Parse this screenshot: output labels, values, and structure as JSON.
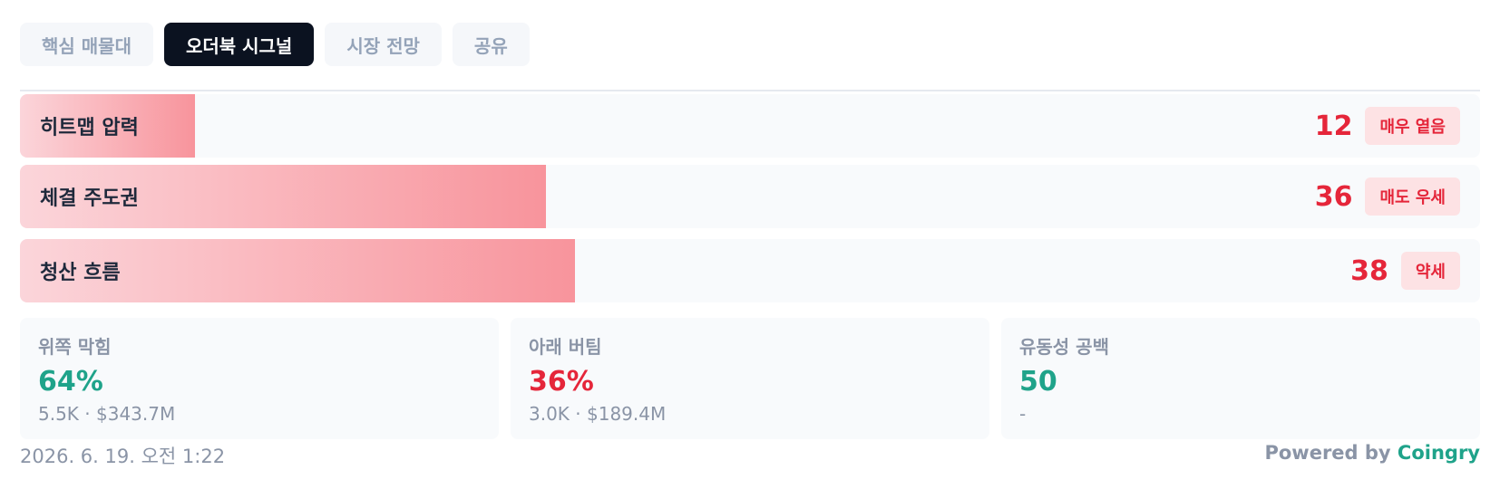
{
  "tabs": [
    {
      "label": "핵심 매물대",
      "active": false
    },
    {
      "label": "오더북 시그널",
      "active": true
    },
    {
      "label": "시장 전망",
      "active": false
    },
    {
      "label": "공유",
      "active": false
    }
  ],
  "signals": [
    {
      "label": "히트맵 압력",
      "value": "12",
      "level": 0.12,
      "badge": "매우 옅음"
    },
    {
      "label": "체결 주도권",
      "value": "36",
      "level": 0.36,
      "badge": "매도 우세"
    },
    {
      "label": "청산 흐름",
      "value": "38",
      "level": 0.38,
      "badge": "약세"
    }
  ],
  "cards": [
    {
      "title": "위쪽 막힘",
      "value": "64%",
      "sub": "5.5K · $343.7M",
      "value_color": "green"
    },
    {
      "title": "아래 버팀",
      "value": "36%",
      "sub": "3.0K · $189.4M",
      "value_color": "red"
    },
    {
      "title": "유동성 공백",
      "value": "50",
      "sub": "-",
      "value_color": "green"
    }
  ],
  "footer": {
    "timestamp": "2026. 6. 19. 오전 1:22",
    "powered_prefix": "Powered by",
    "brand": "Coingry"
  },
  "colors": {
    "accent_red": "#e5263a",
    "accent_green": "#1fa38a",
    "tab_active_bg": "#0b1220"
  }
}
